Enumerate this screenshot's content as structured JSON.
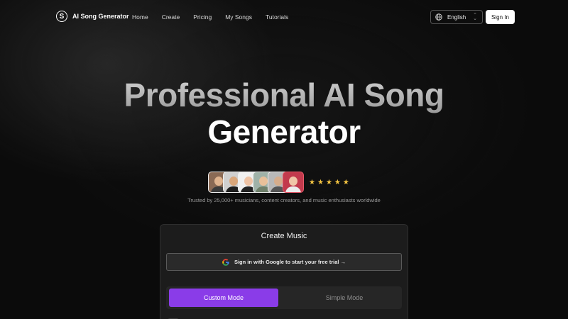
{
  "brand": {
    "logo_letter": "S",
    "name": "AI Song Generator"
  },
  "nav": {
    "links": [
      "Home",
      "Create",
      "Pricing",
      "My Songs",
      "Tutorials"
    ]
  },
  "language": {
    "selected": "English",
    "icon": "globe-icon"
  },
  "signin": {
    "label": "Sign In"
  },
  "hero": {
    "line1": "Professional AI Song",
    "line2": "Generator"
  },
  "social_proof": {
    "avatar_count": 6,
    "stars": [
      "★",
      "★",
      "★",
      "★",
      "★"
    ],
    "rating": 5,
    "trusted_text": "Trusted by 25,000+ musicians, content creators, and music enthusiasts worldwide"
  },
  "create_card": {
    "title": "Create Music",
    "google_button": "Sign in with Google to start your free trial →",
    "modes": {
      "active": "Custom Mode",
      "inactive": "Simple Mode"
    }
  },
  "colors": {
    "accent": "#8a3ce8",
    "star": "#f5c542",
    "background": "#0b0b0b"
  }
}
